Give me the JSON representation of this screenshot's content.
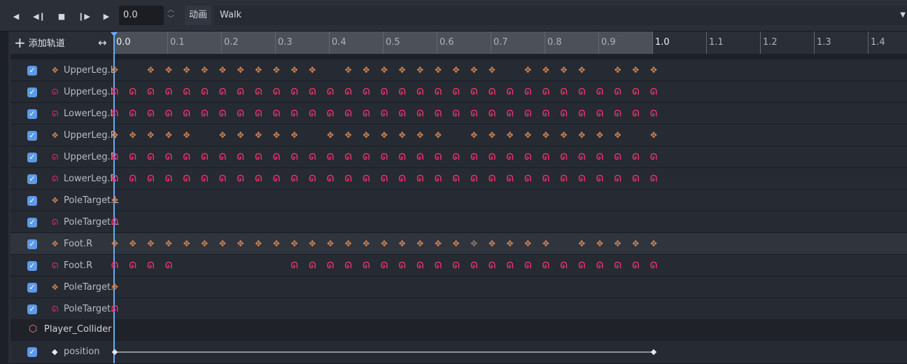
{
  "toolbar": {
    "time_value": "0.0",
    "animation_label": "动画",
    "animation_name": "Walk"
  },
  "header": {
    "add_track_label": "添加轨道",
    "ruler_labels": [
      "0.0",
      "0.1",
      "0.2",
      "0.3",
      "0.4",
      "0.5",
      "0.6",
      "0.7",
      "0.8",
      "0.9",
      "1.0",
      "1.1",
      "1.2",
      "1.3",
      "1.4"
    ]
  },
  "tracks": [
    {
      "name": "UpperLeg.L",
      "type": "position",
      "keys": [
        0,
        2,
        3,
        4,
        5,
        6,
        7,
        8,
        9,
        10,
        11,
        13,
        14,
        15,
        16,
        17,
        18,
        19,
        20,
        21,
        23,
        24,
        25,
        26,
        28,
        29,
        30
      ]
    },
    {
      "name": "UpperLeg.L",
      "type": "rotation",
      "keys": [
        0,
        1,
        2,
        3,
        4,
        5,
        6,
        7,
        8,
        9,
        10,
        11,
        12,
        13,
        14,
        15,
        16,
        17,
        18,
        19,
        20,
        21,
        22,
        23,
        24,
        25,
        26,
        27,
        28,
        29,
        30
      ]
    },
    {
      "name": "LowerLeg.L",
      "type": "rotation",
      "keys": [
        0,
        1,
        2,
        3,
        4,
        5,
        6,
        7,
        8,
        9,
        10,
        11,
        12,
        13,
        14,
        15,
        16,
        17,
        18,
        19,
        20,
        21,
        22,
        23,
        24,
        25,
        26,
        27,
        28,
        29,
        30
      ]
    },
    {
      "name": "UpperLeg.R",
      "type": "position",
      "keys": [
        0,
        1,
        2,
        3,
        4,
        6,
        7,
        8,
        9,
        10,
        12,
        13,
        14,
        15,
        16,
        17,
        18,
        20,
        21,
        22,
        23,
        24,
        25,
        26,
        27,
        28,
        30
      ]
    },
    {
      "name": "UpperLeg.R",
      "type": "rotation",
      "keys": [
        0,
        1,
        2,
        3,
        4,
        5,
        6,
        7,
        8,
        9,
        10,
        11,
        12,
        13,
        14,
        15,
        16,
        17,
        18,
        19,
        20,
        21,
        22,
        23,
        24,
        25,
        26,
        27,
        28,
        29,
        30
      ]
    },
    {
      "name": "LowerLeg.R",
      "type": "rotation",
      "keys": [
        0,
        1,
        2,
        3,
        4,
        5,
        6,
        7,
        8,
        9,
        10,
        11,
        12,
        13,
        14,
        15,
        16,
        17,
        18,
        19,
        20,
        21,
        22,
        23,
        24,
        25,
        26,
        27,
        28,
        29,
        30
      ]
    },
    {
      "name": "PoleTarget.L",
      "type": "position",
      "keys": [
        0
      ]
    },
    {
      "name": "PoleTarget.L",
      "type": "rotation",
      "keys": [
        0
      ]
    },
    {
      "name": "Foot.R",
      "type": "position",
      "keys": [
        0,
        1,
        2,
        3,
        4,
        5,
        6,
        7,
        8,
        9,
        10,
        11,
        12,
        13,
        14,
        15,
        16,
        17,
        18,
        19,
        20,
        21,
        22,
        23,
        24,
        26,
        27,
        28,
        29,
        30
      ],
      "highlight": true
    },
    {
      "name": "Foot.R",
      "type": "rotation",
      "keys": [
        0,
        1,
        2,
        3,
        10,
        11,
        12,
        13,
        14,
        15,
        16,
        17,
        18,
        19,
        20,
        21,
        22,
        23,
        24,
        25,
        26,
        27,
        28,
        29,
        30
      ]
    },
    {
      "name": "PoleTarget.",
      "type": "position",
      "keys": [
        0
      ]
    },
    {
      "name": "PoleTarget.",
      "type": "rotation",
      "keys": [
        0
      ]
    }
  ],
  "group": {
    "name": "Player_Collider",
    "icon": "cube-icon"
  },
  "collider_track": {
    "name": "position",
    "keys": [
      0,
      30
    ]
  },
  "colors": {
    "position_key": "#d88650",
    "rotation_key": "#e8336b",
    "playhead": "#6aaaf0",
    "checkbox": "#5d9ae6"
  }
}
